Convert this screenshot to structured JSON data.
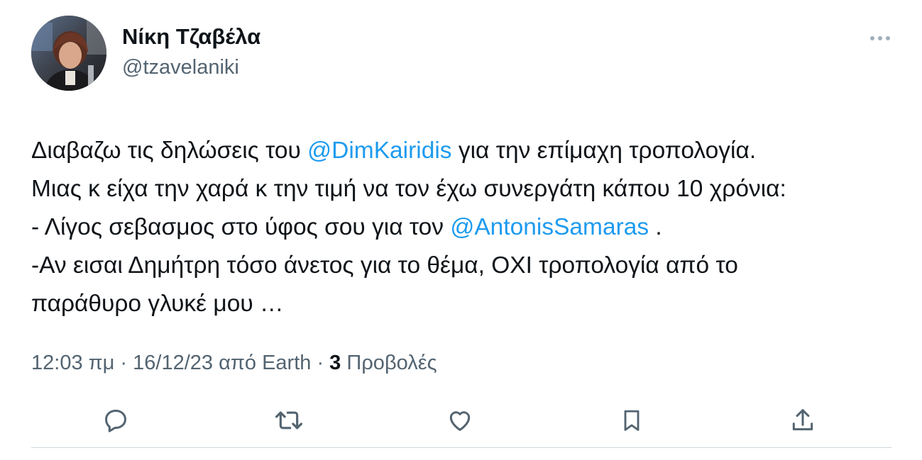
{
  "author": {
    "name": "Νίκη Τζαβέλα",
    "handle": "@tzavelaniki"
  },
  "tweet": {
    "lines": [
      {
        "parts": [
          {
            "text": "Διαβαζω τις δηλώσεις του ",
            "mention": false
          },
          {
            "text": "@DimKairidis",
            "mention": true
          },
          {
            "text": " για την επίμαχη τροπολογία.",
            "mention": false
          }
        ]
      },
      {
        "parts": [
          {
            "text": "Μιας κ είχα την χαρά κ την τιμή να τον έχω συνεργάτη κάπου 10 χρόνια:",
            "mention": false
          }
        ]
      },
      {
        "parts": [
          {
            "text": "- Λίγος σεβασμος στο ύφος σου για τον ",
            "mention": false
          },
          {
            "text": "@AntonisSamaras",
            "mention": true
          },
          {
            "text": " .",
            "mention": false
          }
        ]
      },
      {
        "parts": [
          {
            "text": "-Αν εισαι Δημήτρη τόσο άνετος για το θέμα, ΟΧΙ τροπολογία από το",
            "mention": false
          }
        ]
      },
      {
        "parts": [
          {
            "text": "παράθυρο γλυκέ μου …",
            "mention": false
          }
        ]
      }
    ]
  },
  "meta": {
    "time": "12:03 πμ",
    "separator1": " · ",
    "date": "16/12/23",
    "source_prefix": " από ",
    "source": "Earth",
    "separator2": " · ",
    "views_count": "3",
    "views_label": " Προβολές"
  },
  "actions": [
    {
      "name": "reply-button",
      "icon": "reply-icon"
    },
    {
      "name": "retweet-button",
      "icon": "retweet-icon"
    },
    {
      "name": "like-button",
      "icon": "heart-icon"
    },
    {
      "name": "bookmark-button",
      "icon": "bookmark-icon"
    },
    {
      "name": "share-button",
      "icon": "share-icon"
    }
  ],
  "colors": {
    "text": "#0f1419",
    "secondary": "#536471",
    "mention": "#1d9bf0",
    "divider": "#cfd9de",
    "icon": "#536471"
  }
}
